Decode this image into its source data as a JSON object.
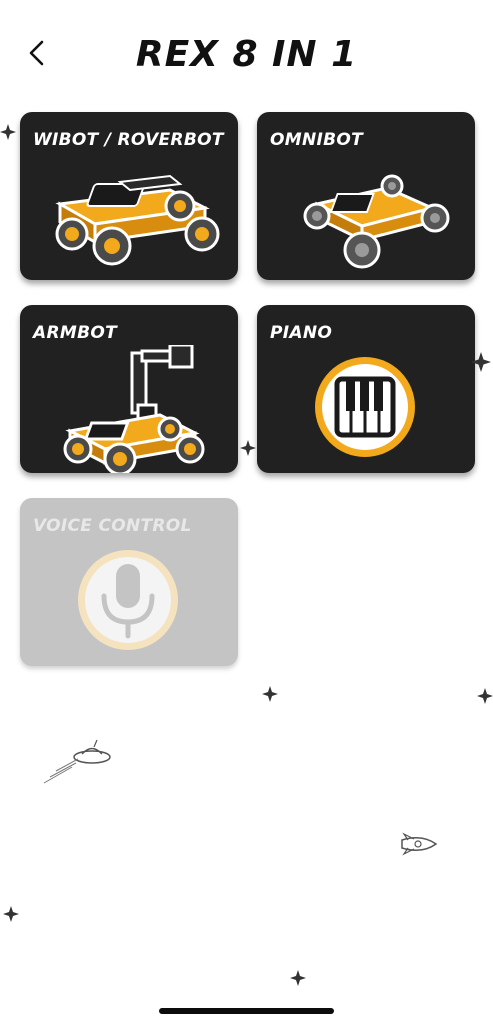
{
  "header": {
    "title": "REX 8 IN 1"
  },
  "cards": [
    {
      "label": "WIBOT / ROVERBOT"
    },
    {
      "label": "OMNIBOT"
    },
    {
      "label": "ARMBOT"
    },
    {
      "label": "PIANO"
    },
    {
      "label": "VOICE CONTROL",
      "state": "disabled"
    }
  ],
  "colors": {
    "card": "#212121",
    "card_disabled": "#c4c4c4",
    "accent": "#f2a91b"
  }
}
